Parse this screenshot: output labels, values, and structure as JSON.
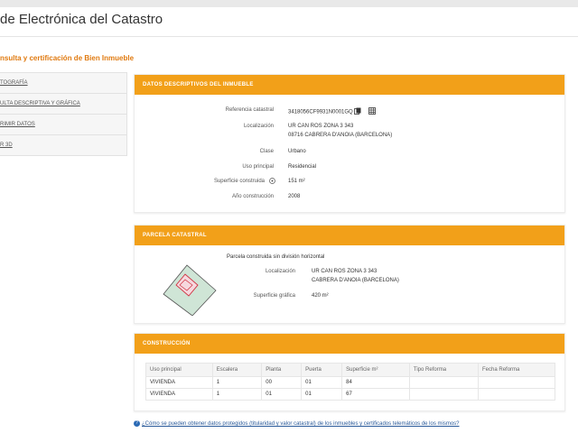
{
  "header": {
    "title": "de Electrónica del Catastro"
  },
  "page": {
    "subtitle": "nsulta y certificación de Bien Inmueble"
  },
  "sidebar": {
    "items": [
      {
        "label": "TOGRAFÍA"
      },
      {
        "label": "ULTA DESCRIPTIVA Y GRÁFICA"
      },
      {
        "label": "RIMIR DATOS"
      },
      {
        "label": "R 3D"
      }
    ]
  },
  "datos": {
    "heading": "DATOS DESCRIPTIVOS DEL INMUEBLE",
    "fields": [
      {
        "label": "Referencia catastral",
        "value": "3418056CF9931N0001GQ"
      },
      {
        "label": "Localización",
        "value": "UR CAN ROS ZONA 3 343",
        "value2": "08716 CABRERA D'ANOIA (BARCELONA)"
      },
      {
        "label": "Clase",
        "value": "Urbano"
      },
      {
        "label": "Uso principal",
        "value": "Residencial"
      },
      {
        "label": "Superficie construida",
        "value": "151 m²"
      },
      {
        "label": "Año construcción",
        "value": "2008"
      }
    ]
  },
  "parcela": {
    "heading": "PARCELA CATASTRAL",
    "caption": "Parcela construida sin división horizontal",
    "loc_label": "Localización",
    "loc_value": "UR CAN ROS ZONA 3 343",
    "loc_value2": "CABRERA D'ANOIA (BARCELONA)",
    "sup_label": "Superficie gráfica",
    "sup_value": "420 m²"
  },
  "construccion": {
    "heading": "CONSTRUCCIÓN",
    "columns": [
      "Uso principal",
      "Escalera",
      "Planta",
      "Puerta",
      "Superficie m²",
      "Tipo Reforma",
      "Fecha Reforma"
    ],
    "rows": [
      [
        "VIVIENDA",
        "1",
        "00",
        "01",
        "84",
        "",
        ""
      ],
      [
        "VIVIENDA",
        "1",
        "01",
        "01",
        "67",
        "",
        ""
      ]
    ]
  },
  "footer": {
    "link": "¿Cómo se pueden obtener datos protegidos (titularidad y valor catastral) de los inmuebles y certificados telemáticos de los mismos?"
  },
  "colors": {
    "accent": "#f2a019",
    "subtitle": "#e07a10",
    "link": "#2a5a9a"
  }
}
